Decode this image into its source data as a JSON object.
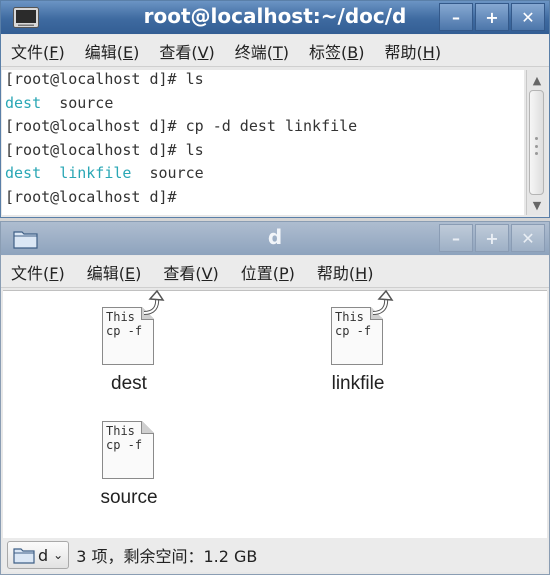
{
  "terminal": {
    "title": "root@localhost:~/doc/d",
    "menu": [
      {
        "label": "文件(",
        "key": "F",
        "end": ")"
      },
      {
        "label": "编辑(",
        "key": "E",
        "end": ")"
      },
      {
        "label": "查看(",
        "key": "V",
        "end": ")"
      },
      {
        "label": "终端(",
        "key": "T",
        "end": ")"
      },
      {
        "label": "标签(",
        "key": "B",
        "end": ")"
      },
      {
        "label": "帮助(",
        "key": "H",
        "end": ")"
      }
    ],
    "lines": [
      {
        "prompt": "[root@localhost d]# ",
        "cmd": "ls"
      },
      {
        "out": [
          "dest",
          "  ",
          "source"
        ]
      },
      {
        "prompt": "[root@localhost d]# ",
        "cmd": "cp -d dest linkfile"
      },
      {
        "prompt": "[root@localhost d]# ",
        "cmd": "ls"
      },
      {
        "out": [
          "dest",
          "  ",
          "linkfile",
          "  ",
          "source"
        ]
      },
      {
        "prompt": "[root@localhost d]#",
        "cmd": ""
      }
    ],
    "window_buttons": {
      "minimize": "–",
      "maximize": "+",
      "close": "✕"
    }
  },
  "file_manager": {
    "title": "d",
    "menu": [
      {
        "label": "文件(",
        "key": "F",
        "end": ")"
      },
      {
        "label": "编辑(",
        "key": "E",
        "end": ")"
      },
      {
        "label": "查看(",
        "key": "V",
        "end": ")"
      },
      {
        "label": "位置(",
        "key": "P",
        "end": ")"
      },
      {
        "label": "帮助(",
        "key": "H",
        "end": ")"
      }
    ],
    "files": [
      {
        "name": "dest",
        "preview": "This\ncp -f",
        "is_link": true
      },
      {
        "name": "linkfile",
        "preview": "This\ncp -f",
        "is_link": true
      },
      {
        "name": "source",
        "preview": "This\ncp -f",
        "is_link": false
      }
    ],
    "status": {
      "location": "d",
      "info": "3 项，剩余空间：1.2 GB"
    },
    "window_buttons": {
      "minimize": "–",
      "maximize": "+",
      "close": "✕"
    }
  },
  "colors": {
    "title_active": "#3e6aa0",
    "title_inactive": "#8ea3bd",
    "terminal_cyan": "#2aa7b5"
  }
}
